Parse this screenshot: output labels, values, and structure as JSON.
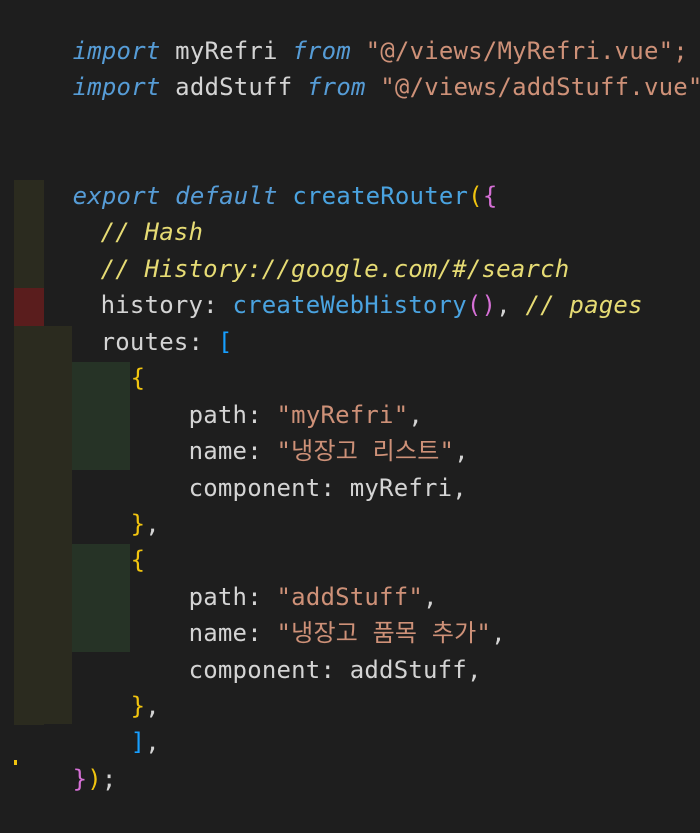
{
  "code": {
    "l1": {
      "kw1": "import",
      "id": " myRefri ",
      "kw2": "from",
      "str": " \"@/views/MyRefri.vue\";"
    },
    "l2": {
      "kw1": "import",
      "id": " addStuff ",
      "kw2": "from",
      "str": " \"@/views/addStuff.vue\";"
    },
    "l5": {
      "kw1": "export",
      "kw2": " default ",
      "fn": "createRouter",
      "open": "(",
      "brace": "{"
    },
    "l6": {
      "cmt": "// Hash"
    },
    "l7": {
      "cmt": "// History://google.com/#/search"
    },
    "l8": {
      "prop": "history: ",
      "fn": "createWebHistory",
      "paren": "()",
      "rest": ", ",
      "cmt": "// pages"
    },
    "l9": {
      "prop": "routes: ",
      "bracket": "["
    },
    "l10": {
      "brace": "{"
    },
    "l11": {
      "prop": "path: ",
      "str": "\"myRefri\"",
      "comma": ","
    },
    "l12": {
      "prop": "name: ",
      "str": "\"냉장고 리스트\"",
      "comma": ","
    },
    "l13": {
      "prop": "component: myRefri,"
    },
    "l14": {
      "brace": "}",
      "comma": ","
    },
    "l15": {
      "brace": "{"
    },
    "l16": {
      "prop": "path: ",
      "str": "\"addStuff\"",
      "comma": ","
    },
    "l17": {
      "prop": "name: ",
      "str": "\"냉장고 품목 추가\"",
      "comma": ","
    },
    "l18": {
      "prop": "component: addStuff,"
    },
    "l19": {
      "brace": "}",
      "comma": ","
    },
    "l20": {
      "bracket": "]",
      "comma": ","
    },
    "l21": {
      "brace": "}",
      "paren": ")",
      "semi": ";"
    }
  },
  "colors": {
    "background": "#1e1e1e",
    "keyword": "#569cd6",
    "string": "#ce9178",
    "function": "#4ec9b0",
    "comment": "#e6db74",
    "bracket_yellow": "#f1c40f",
    "bracket_purple": "#d670d6",
    "bracket_blue": "#179fff"
  }
}
